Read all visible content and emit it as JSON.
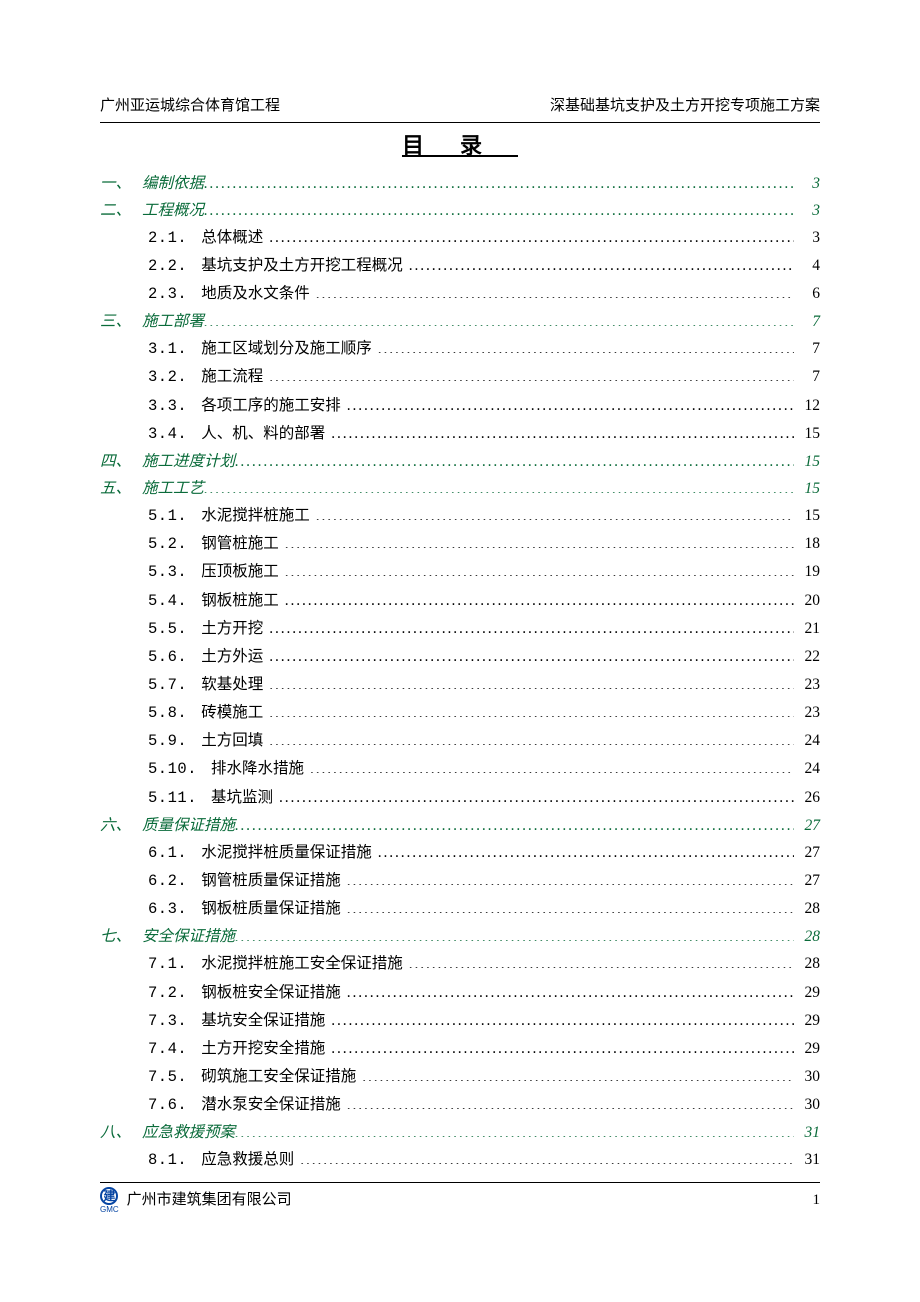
{
  "header": {
    "left": "广州亚运城综合体育馆工程",
    "right": "深基础基坑支护及土方开挖专项施工方案"
  },
  "title": "目录",
  "toc": [
    {
      "lvl": 1,
      "num": "一、",
      "label": "编制依据",
      "page": "3"
    },
    {
      "lvl": 1,
      "num": "二、",
      "label": "工程概况",
      "page": "3"
    },
    {
      "lvl": 2,
      "num": "2.1.",
      "label": "总体概述",
      "page": "3"
    },
    {
      "lvl": 2,
      "num": "2.2.",
      "label": "基坑支护及土方开挖工程概况",
      "page": "4"
    },
    {
      "lvl": 2,
      "num": "2.3.",
      "label": "地质及水文条件",
      "page": "6"
    },
    {
      "lvl": 1,
      "num": "三、",
      "label": "施工部署",
      "page": "7"
    },
    {
      "lvl": 2,
      "num": "3.1.",
      "label": "施工区域划分及施工顺序",
      "page": "7"
    },
    {
      "lvl": 2,
      "num": "3.2.",
      "label": "施工流程",
      "page": "7"
    },
    {
      "lvl": 2,
      "num": "3.3.",
      "label": "各项工序的施工安排",
      "page": "12"
    },
    {
      "lvl": 2,
      "num": "3.4.",
      "label": "人、机、料的部署",
      "page": "15"
    },
    {
      "lvl": 1,
      "num": "四、",
      "label": "施工进度计划",
      "page": "15"
    },
    {
      "lvl": 1,
      "num": "五、",
      "label": "施工工艺",
      "page": "15"
    },
    {
      "lvl": 2,
      "num": "5.1.",
      "label": "水泥搅拌桩施工",
      "page": "15"
    },
    {
      "lvl": 2,
      "num": "5.2.",
      "label": "钢管桩施工",
      "page": "18"
    },
    {
      "lvl": 2,
      "num": "5.3.",
      "label": "压顶板施工",
      "page": "19"
    },
    {
      "lvl": 2,
      "num": "5.4.",
      "label": "钢板桩施工",
      "page": "20"
    },
    {
      "lvl": 2,
      "num": "5.5.",
      "label": "土方开挖",
      "page": "21"
    },
    {
      "lvl": 2,
      "num": "5.6.",
      "label": "土方外运",
      "page": "22"
    },
    {
      "lvl": 2,
      "num": "5.7.",
      "label": "软基处理",
      "page": "23"
    },
    {
      "lvl": 2,
      "num": "5.8.",
      "label": "砖模施工",
      "page": "23"
    },
    {
      "lvl": 2,
      "num": "5.9.",
      "label": "土方回填",
      "page": "24"
    },
    {
      "lvl": 2,
      "num": "5.10.",
      "label": "排水降水措施",
      "page": "24"
    },
    {
      "lvl": 2,
      "num": "5.11.",
      "label": "基坑监测",
      "page": "26"
    },
    {
      "lvl": 1,
      "num": "六、",
      "label": "质量保证措施",
      "page": "27"
    },
    {
      "lvl": 2,
      "num": "6.1.",
      "label": "水泥搅拌桩质量保证措施",
      "page": "27"
    },
    {
      "lvl": 2,
      "num": "6.2.",
      "label": "钢管桩质量保证措施",
      "page": "27"
    },
    {
      "lvl": 2,
      "num": "6.3.",
      "label": "钢板桩质量保证措施",
      "page": "28"
    },
    {
      "lvl": 1,
      "num": "七、",
      "label": "安全保证措施",
      "page": "28"
    },
    {
      "lvl": 2,
      "num": "7.1.",
      "label": "水泥搅拌桩施工安全保证措施",
      "page": "28"
    },
    {
      "lvl": 2,
      "num": "7.2.",
      "label": "钢板桩安全保证措施",
      "page": "29"
    },
    {
      "lvl": 2,
      "num": "7.3.",
      "label": "基坑安全保证措施",
      "page": "29"
    },
    {
      "lvl": 2,
      "num": "7.4.",
      "label": "土方开挖安全措施",
      "page": "29"
    },
    {
      "lvl": 2,
      "num": "7.5.",
      "label": "砌筑施工安全保证措施",
      "page": "30"
    },
    {
      "lvl": 2,
      "num": "7.6.",
      "label": "潜水泵安全保证措施",
      "page": "30"
    },
    {
      "lvl": 1,
      "num": "八、",
      "label": "应急救援预案",
      "page": "31"
    },
    {
      "lvl": 2,
      "num": "8.1.",
      "label": "应急救援总则",
      "page": "31"
    }
  ],
  "footer": {
    "logo_text": "GMC",
    "company": "广州市建筑集团有限公司",
    "page_no": "1"
  }
}
